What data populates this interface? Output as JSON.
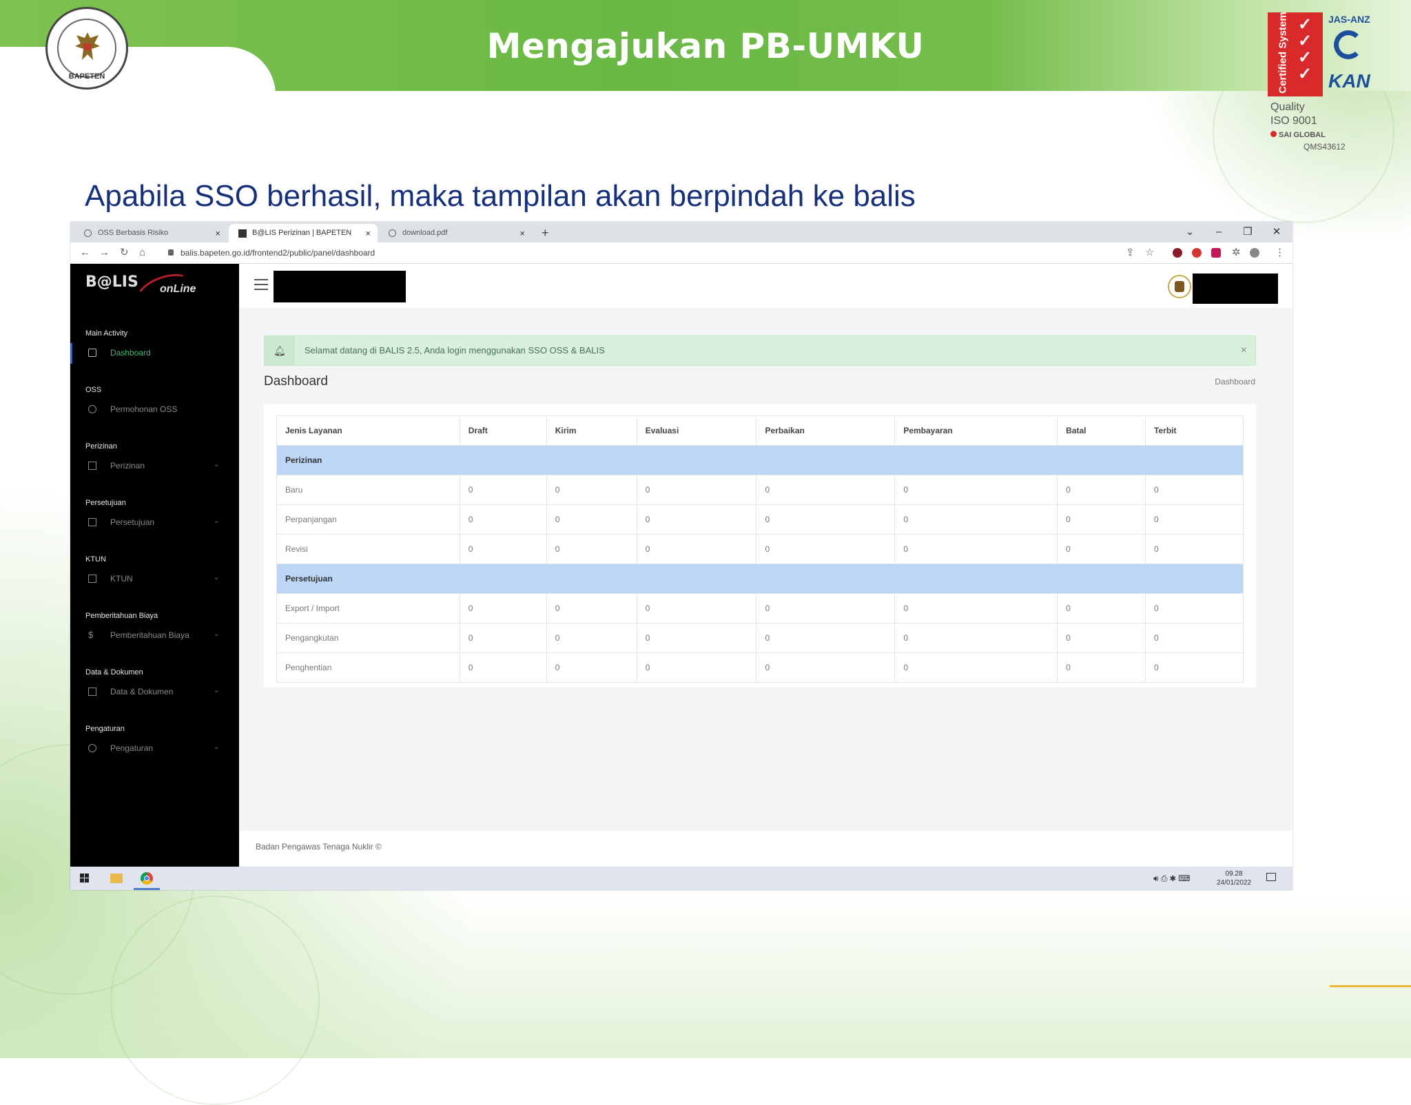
{
  "slide": {
    "title": "Mengajukan PB-UMKU",
    "subtitle": "Apabila SSO berhasil, maka tampilan akan berpindah ke balis",
    "logo_text": "BAPETEN",
    "cert": {
      "vertical": "Certified System",
      "org": "JAS-ANZ",
      "kan": "KAN",
      "quality": "Quality",
      "iso": "ISO 9001",
      "sai": "SAI GLOBAL",
      "qms": "QMS43612"
    }
  },
  "browser": {
    "tabs": [
      {
        "label": "OSS Berbasis Risiko"
      },
      {
        "label": "B@LIS Perizinan | BAPETEN"
      },
      {
        "label": "download.pdf"
      }
    ],
    "url": "balis.bapeten.go.id/frontend2/public/panel/dashboard"
  },
  "app": {
    "brand": "B@LIS",
    "brand_sub": "onLine",
    "sidebar": [
      {
        "section": "Main Activity",
        "label": "Dashboard",
        "active": true,
        "chevron": false
      },
      {
        "section": "OSS",
        "label": "Permohonan OSS",
        "active": false,
        "chevron": false
      },
      {
        "section": "Perizinan",
        "label": "Perizinan",
        "active": false,
        "chevron": true
      },
      {
        "section": "Persetujuan",
        "label": "Persetujuan",
        "active": false,
        "chevron": true
      },
      {
        "section": "KTUN",
        "label": "KTUN",
        "active": false,
        "chevron": true
      },
      {
        "section": "Pemberitahuan Biaya",
        "label": "Pemberitahuan Biaya",
        "active": false,
        "chevron": true
      },
      {
        "section": "Data & Dokumen",
        "label": "Data & Dokumen",
        "active": false,
        "chevron": true
      },
      {
        "section": "Pengaturan",
        "label": "Pengaturan",
        "active": false,
        "chevron": true
      }
    ],
    "alert": "Selamat datang di BALIS 2.5, Anda login menggunakan SSO OSS & BALIS",
    "page_title": "Dashboard",
    "breadcrumb": "Dashboard",
    "table": {
      "headers": [
        "Jenis Layanan",
        "Draft",
        "Kirim",
        "Evaluasi",
        "Perbaikan",
        "Pembayaran",
        "Batal",
        "Terbit"
      ],
      "groups": [
        {
          "name": "Perizinan",
          "rows": [
            {
              "label": "Baru",
              "values": [
                "0",
                "0",
                "0",
                "0",
                "0",
                "0",
                "0"
              ]
            },
            {
              "label": "Perpanjangan",
              "values": [
                "0",
                "0",
                "0",
                "0",
                "0",
                "0",
                "0"
              ]
            },
            {
              "label": "Revisi",
              "values": [
                "0",
                "0",
                "0",
                "0",
                "0",
                "0",
                "0"
              ]
            }
          ]
        },
        {
          "name": "Persetujuan",
          "rows": [
            {
              "label": "Export / Import",
              "values": [
                "0",
                "0",
                "0",
                "0",
                "0",
                "0",
                "0"
              ]
            },
            {
              "label": "Pengangkutan",
              "values": [
                "0",
                "0",
                "0",
                "0",
                "0",
                "0",
                "0"
              ]
            },
            {
              "label": "Penghentian",
              "values": [
                "0",
                "0",
                "0",
                "0",
                "0",
                "0",
                "0"
              ]
            }
          ]
        }
      ]
    },
    "footer": "Badan Pengawas Tenaga Nuklir ©"
  },
  "taskbar": {
    "time": "09.28",
    "date": "24/01/2022"
  }
}
